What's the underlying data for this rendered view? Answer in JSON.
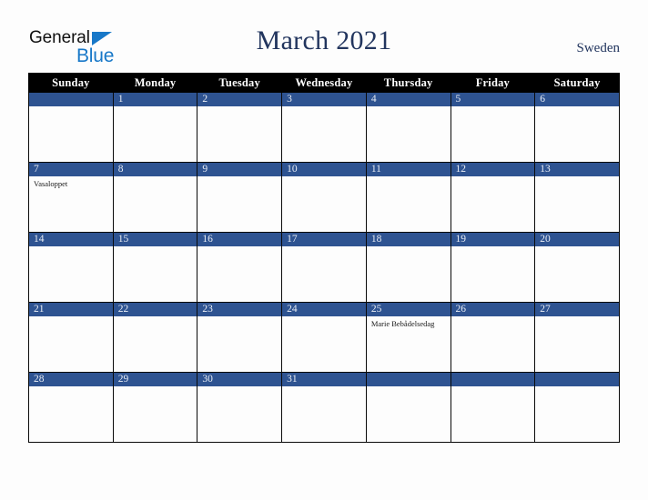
{
  "brand": {
    "name_part1": "General",
    "name_part2": "Blue",
    "accent_color": "#1878c8",
    "triangle_icon": "triangle-right-icon"
  },
  "header": {
    "title": "March 2021",
    "country": "Sweden",
    "title_color": "#22355e"
  },
  "theme": {
    "band_blue": "#2e5391",
    "header_black": "#000000",
    "page_background": "#fdfdfd",
    "cell_background": "#fdfdfd",
    "daynum_text": "#e9edf5"
  },
  "weekdays": [
    "Sunday",
    "Monday",
    "Tuesday",
    "Wednesday",
    "Thursday",
    "Friday",
    "Saturday"
  ],
  "weeks": [
    [
      {
        "day": "",
        "events": []
      },
      {
        "day": "1",
        "events": []
      },
      {
        "day": "2",
        "events": []
      },
      {
        "day": "3",
        "events": []
      },
      {
        "day": "4",
        "events": []
      },
      {
        "day": "5",
        "events": []
      },
      {
        "day": "6",
        "events": []
      }
    ],
    [
      {
        "day": "7",
        "events": [
          "Vasaloppet"
        ]
      },
      {
        "day": "8",
        "events": []
      },
      {
        "day": "9",
        "events": []
      },
      {
        "day": "10",
        "events": []
      },
      {
        "day": "11",
        "events": []
      },
      {
        "day": "12",
        "events": []
      },
      {
        "day": "13",
        "events": []
      }
    ],
    [
      {
        "day": "14",
        "events": []
      },
      {
        "day": "15",
        "events": []
      },
      {
        "day": "16",
        "events": []
      },
      {
        "day": "17",
        "events": []
      },
      {
        "day": "18",
        "events": []
      },
      {
        "day": "19",
        "events": []
      },
      {
        "day": "20",
        "events": []
      }
    ],
    [
      {
        "day": "21",
        "events": []
      },
      {
        "day": "22",
        "events": []
      },
      {
        "day": "23",
        "events": []
      },
      {
        "day": "24",
        "events": []
      },
      {
        "day": "25",
        "events": [
          "Marie Bebådelsedag"
        ]
      },
      {
        "day": "26",
        "events": []
      },
      {
        "day": "27",
        "events": []
      }
    ],
    [
      {
        "day": "28",
        "events": []
      },
      {
        "day": "29",
        "events": []
      },
      {
        "day": "30",
        "events": []
      },
      {
        "day": "31",
        "events": []
      },
      {
        "day": "",
        "events": []
      },
      {
        "day": "",
        "events": []
      },
      {
        "day": "",
        "events": []
      }
    ]
  ]
}
